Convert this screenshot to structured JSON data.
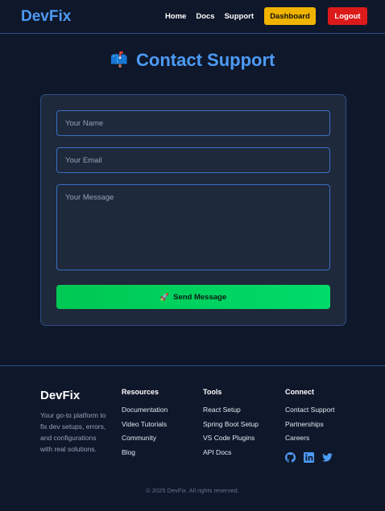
{
  "nav": {
    "brand": "DevFix",
    "links": [
      "Home",
      "Docs",
      "Support"
    ],
    "dashboard_label": "Dashboard",
    "logout_label": "Logout",
    "dashboard_color": "#f0b400",
    "logout_color": "#dc1a1a"
  },
  "page": {
    "title": "Contact Support",
    "title_icon": "mailbox-icon"
  },
  "form": {
    "name_placeholder": "Your Name",
    "email_placeholder": "Your Email",
    "message_placeholder": "Your Message",
    "name_value": "",
    "email_value": "",
    "message_value": "",
    "submit_label": "Send Message",
    "submit_icon": "rocket-icon",
    "submit_color": "#00c853"
  },
  "footer": {
    "brand": "DevFix",
    "tagline": "Your go-to platform to fix dev setups, errors, and configurations with real solutions.",
    "columns": [
      {
        "title": "Resources",
        "items": [
          "Documentation",
          "Video Tutorials",
          "Community",
          "Blog"
        ]
      },
      {
        "title": "Tools",
        "items": [
          "React Setup",
          "Spring Boot Setup",
          "VS Code Plugins",
          "API Docs"
        ]
      },
      {
        "title": "Connect",
        "items": [
          "Contact Support",
          "Partnerships",
          "Careers"
        ]
      }
    ],
    "socials": [
      "github-icon",
      "linkedin-icon",
      "twitter-icon"
    ],
    "copyright": "© 2025 DevFix. All rights reserved."
  },
  "colors": {
    "background": "#0f172a",
    "accent": "#4d9bf5",
    "card": "#1e293b"
  }
}
